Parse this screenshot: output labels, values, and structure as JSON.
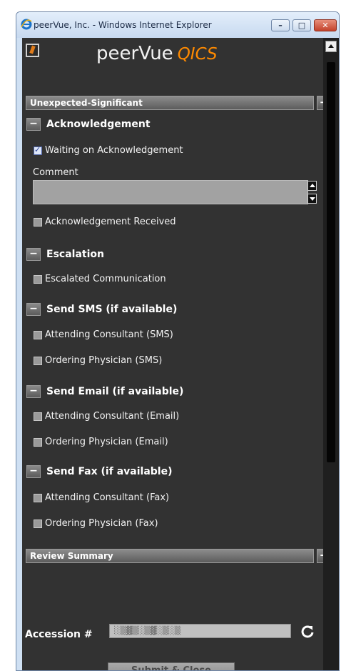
{
  "window": {
    "title": "peerVue, Inc. - Windows Internet Explorer"
  },
  "header": {
    "brand": "peerVue",
    "product": "QICS"
  },
  "panel": {
    "title": "Unexpected-Significant",
    "toggle": "−"
  },
  "sections": [
    {
      "title": "Acknowledgement",
      "toggle": "−",
      "items": [
        {
          "label": "Waiting on Acknowledgement",
          "checked": true
        },
        {
          "label": "Acknowledgement Received",
          "checked": false
        }
      ],
      "comment_label": "Comment",
      "comment_value": ""
    },
    {
      "title": "Escalation",
      "toggle": "−",
      "items": [
        {
          "label": "Escalated Communication",
          "checked": false
        }
      ]
    },
    {
      "title": "Send SMS (if available)",
      "toggle": "−",
      "items": [
        {
          "label": "Attending Consultant (SMS)",
          "checked": false
        },
        {
          "label": "Ordering Physician (SMS)",
          "checked": false
        }
      ]
    },
    {
      "title": "Send Email (if available)",
      "toggle": "−",
      "items": [
        {
          "label": "Attending Consultant (Email)",
          "checked": false
        },
        {
          "label": "Ordering Physician (Email)",
          "checked": false
        }
      ]
    },
    {
      "title": "Send Fax (if available)",
      "toggle": "−",
      "items": [
        {
          "label": "Attending Consultant (Fax)",
          "checked": false
        },
        {
          "label": "Ordering Physician (Fax)",
          "checked": false
        }
      ]
    }
  ],
  "review": {
    "title": "Review Summary",
    "toggle": "+"
  },
  "accession": {
    "label": "Accession #",
    "value": "░▒▓▒░▒▓░▒░▒"
  },
  "submit": {
    "label": "Submit & Close"
  },
  "colors": {
    "accent": "#ff8a00",
    "background": "#323232",
    "bar": "#6e6e6e"
  }
}
